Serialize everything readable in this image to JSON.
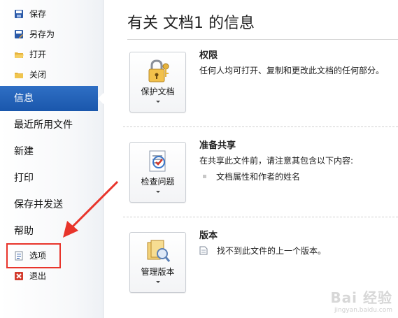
{
  "nav": {
    "commands": [
      {
        "label": "保存",
        "icon": "save-icon"
      },
      {
        "label": "另存为",
        "icon": "save-as-icon"
      },
      {
        "label": "打开",
        "icon": "open-folder-icon"
      },
      {
        "label": "关闭",
        "icon": "close-folder-icon"
      }
    ],
    "tabs": [
      {
        "label": "信息",
        "active": true
      },
      {
        "label": "最近所用文件"
      },
      {
        "label": "新建"
      },
      {
        "label": "打印"
      },
      {
        "label": "保存并发送"
      },
      {
        "label": "帮助"
      }
    ],
    "bottom_commands": [
      {
        "label": "选项",
        "icon": "options-icon"
      },
      {
        "label": "退出",
        "icon": "exit-icon"
      }
    ]
  },
  "main": {
    "title": "有关 文档1 的信息",
    "sections": [
      {
        "button_label": "保护文档",
        "button_icon": "lock-key-icon",
        "title": "权限",
        "description": "任何人均可打开、复制和更改此文档的任何部分。"
      },
      {
        "button_label": "检查问题",
        "button_icon": "checklist-icon",
        "title": "准备共享",
        "description": "在共享此文件前，请注意其包含以下内容:",
        "bullets": [
          "文档属性和作者的姓名"
        ]
      },
      {
        "button_label": "管理版本",
        "button_icon": "versions-icon",
        "title": "版本",
        "description": "找不到此文件的上一个版本。"
      }
    ]
  },
  "watermark": {
    "text": "Bai 经验",
    "sub": "jingyan.baidu.com"
  },
  "colors": {
    "accent": "#1a57ac",
    "highlight": "#e8342b"
  }
}
